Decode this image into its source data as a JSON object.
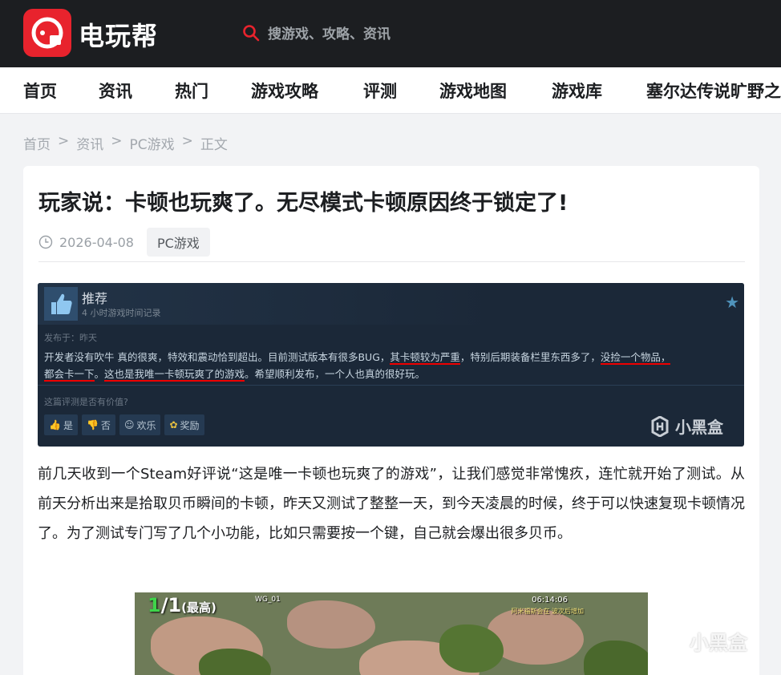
{
  "header": {
    "logo_text": "电玩帮",
    "logo_badge_letter": "G",
    "search_placeholder": "搜游戏、攻略、资讯"
  },
  "nav": {
    "items": [
      "首页",
      "资讯",
      "热门",
      "游戏攻略",
      "评测",
      "游戏地图",
      "游戏库",
      "塞尔达传说旷野之"
    ]
  },
  "breadcrumb": {
    "items": [
      "首页",
      "资讯",
      "PC游戏",
      "正文"
    ],
    "separator": ">"
  },
  "article": {
    "title": "玩家说：卡顿也玩爽了。无尽模式卡顿原因终于锁定了!",
    "date": "2026-04-08",
    "tag": "PC游戏",
    "body": "前几天收到一个Steam好评说“这是唯一卡顿也玩爽了的游戏”，让我们感觉非常愧疚，连忙就开始了测试。从前天分析出来是拾取贝币瞬间的卡顿，昨天又测试了整整一天，到今天凌晨的时候，终于可以快速复现卡顿情况了。为了测试专门写了几个小功能，比如只需要按一个键，自己就会爆出很多贝币。"
  },
  "review": {
    "title": "推荐",
    "hours": "4 小时游戏时间记录",
    "posted": "发布于：昨天",
    "text": {
      "a": "开发者没有吹牛 真的很爽，特效和震动恰到超出。目前测试版本有很多BUG，",
      "b": "其卡顿较为严重",
      "c": "，特别后期装备栏里东西多了，",
      "d": "没捡一个物品，",
      "e": "都会卡一下",
      "f": "。",
      "g": "这也是我唯一卡顿玩爽了的游戏",
      "h": "。希望顺利发布，一个人也真的很好玩。"
    },
    "helpful_question": "这篇评测是否有价值?",
    "votes": [
      "是",
      "否",
      "欢乐",
      "奖励"
    ],
    "watermark": "小黑盒"
  },
  "game_screenshot": {
    "wave": "1/1",
    "wave_current": "1",
    "wave_total": "/1",
    "difficulty": "(最高)",
    "player_tag": "WG_01",
    "time": "06:14:06",
    "message": "阿米福斯会在 波次后增加"
  },
  "page_watermark": "小黑盒",
  "colors": {
    "brand_red": "#e8232d",
    "topbar_bg": "#1c1e21",
    "steam_bg": "#1b2838",
    "underline_red": "#ee0000",
    "game_green": "#3fd44a"
  }
}
